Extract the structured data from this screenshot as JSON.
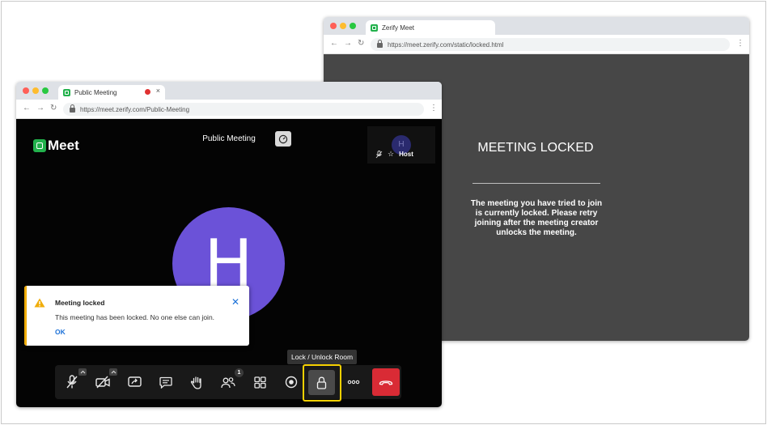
{
  "back_window": {
    "tab_title": "Zerify Meet",
    "url": "https://meet.zerify.com/static/locked.html",
    "heading": "MEETING LOCKED",
    "message": "The meeting you have tried to join is currently locked. Please retry joining after the meeting creator unlocks the meeting."
  },
  "front_window": {
    "tab_title": "Public Meeting",
    "url": "https://meet.zerify.com/Public-Meeting"
  },
  "meeting": {
    "logo_text": "Meet",
    "title": "Public Meeting",
    "avatar_letter": "H",
    "thumbnail_letter": "H",
    "host_label": "Host"
  },
  "toast": {
    "title": "Meeting locked",
    "body": "This meeting has been locked. No one else can join.",
    "action": "OK"
  },
  "tooltip": "Lock / Unlock Room",
  "toolbar": {
    "participants_count": "1"
  },
  "colors": {
    "accent_green": "#22b14c",
    "avatar_purple": "#6b52d8",
    "highlight_yellow": "#f5d000",
    "hangup_red": "#d92b35",
    "link_blue": "#1d72d8",
    "warning_orange": "#f0ad0a"
  },
  "icons": [
    "microphone-muted-icon",
    "camera-off-icon",
    "share-screen-icon",
    "chat-icon",
    "raise-hand-icon",
    "participants-icon",
    "tile-view-icon",
    "record-icon",
    "lock-icon",
    "more-icon",
    "hangup-icon",
    "speedometer-icon",
    "star-icon",
    "warning-icon",
    "close-icon"
  ]
}
